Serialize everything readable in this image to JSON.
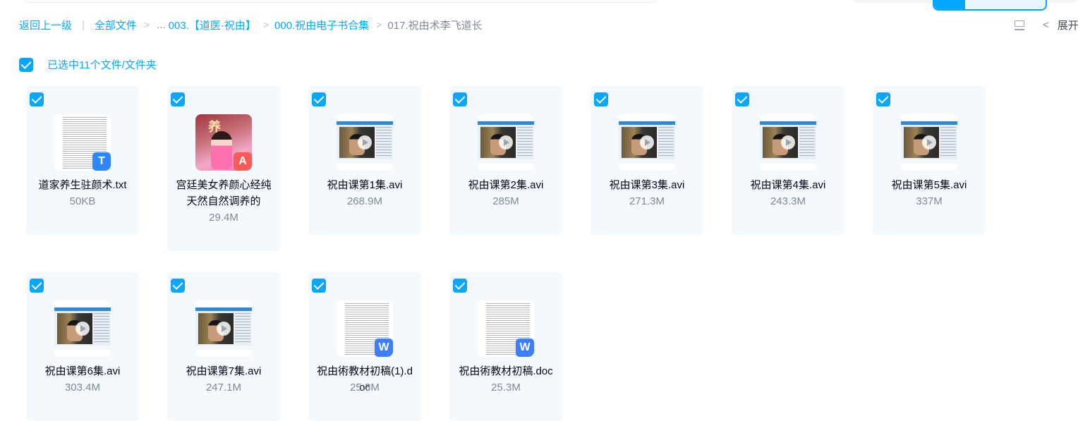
{
  "breadcrumb": {
    "back": "返回上一级",
    "separator": "|",
    "all_files": "全部文件",
    "ellipsis": "...",
    "items": [
      "003.【道医·祝由】",
      "000.祝由电子书合集"
    ],
    "current": "017.祝由术李飞道长"
  },
  "toolbar": {
    "expand_label": "展开"
  },
  "selection": {
    "label": "已选中11个文件/文件夹"
  },
  "files": [
    {
      "name": "道家养生驻颜术.txt",
      "size": "50KB",
      "type": "txt",
      "icon": "txt-file-icon"
    },
    {
      "name": "宫廷美女养颜心经纯天然自然调养的",
      "size": "29.4M",
      "type": "pdf",
      "icon": "pdf-file-icon"
    },
    {
      "name": "祝由课第1集.avi",
      "size": "268.9M",
      "type": "video",
      "icon": "play-icon"
    },
    {
      "name": "祝由课第2集.avi",
      "size": "285M",
      "type": "video",
      "icon": "play-icon"
    },
    {
      "name": "祝由课第3集.avi",
      "size": "271.3M",
      "type": "video",
      "icon": "play-icon"
    },
    {
      "name": "祝由课第4集.avi",
      "size": "243.3M",
      "type": "video",
      "icon": "play-icon"
    },
    {
      "name": "祝由课第5集.avi",
      "size": "337M",
      "type": "video",
      "icon": "play-icon"
    },
    {
      "name": "祝由课第6集.avi",
      "size": "303.4M",
      "type": "video",
      "icon": "play-icon"
    },
    {
      "name": "祝由课第7集.avi",
      "size": "247.1M",
      "type": "video",
      "icon": "play-icon"
    },
    {
      "name": "祝由術教材初稿(1).doc",
      "size": "25.3M",
      "type": "doc",
      "icon": "word-file-icon"
    },
    {
      "name": "祝由術教材初稿.doc",
      "size": "25.3M",
      "type": "doc",
      "icon": "word-file-icon"
    }
  ],
  "badges": {
    "txt": "T",
    "pdf": "A",
    "doc": "W",
    "pdf_cover_text": "养"
  },
  "colors": {
    "accent": "#06a7ff",
    "card_bg": "#f3f9fd",
    "muted_text": "#818999"
  }
}
